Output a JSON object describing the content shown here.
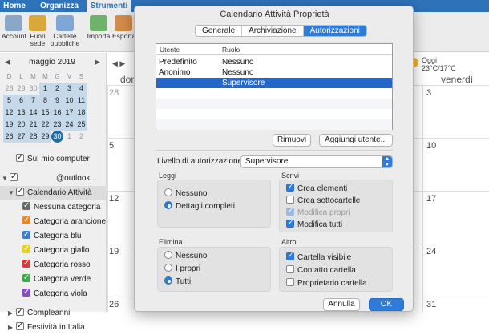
{
  "ribbon": {
    "tabs": [
      {
        "label": "Home",
        "active": false
      },
      {
        "label": "Organizza",
        "active": false
      },
      {
        "label": "Strumenti",
        "active": true
      }
    ],
    "buttons": [
      {
        "label": "Account",
        "icon": "account-icon"
      },
      {
        "label": "Fuori sede",
        "icon": "out-of-office-icon"
      },
      {
        "label": "Cartelle pubbliche",
        "icon": "public-folders-icon"
      },
      {
        "label": "Importa",
        "icon": "import-icon"
      },
      {
        "label": "Esporta",
        "icon": "export-icon"
      }
    ]
  },
  "mini_calendar": {
    "month_label": "maggio 2019",
    "weekdays": [
      "D",
      "L",
      "M",
      "M",
      "G",
      "V",
      "S"
    ],
    "weeks": [
      [
        "28",
        "29",
        "30",
        "1",
        "2",
        "3",
        "4"
      ],
      [
        "5",
        "6",
        "7",
        "8",
        "9",
        "10",
        "11"
      ],
      [
        "12",
        "13",
        "14",
        "15",
        "16",
        "17",
        "18"
      ],
      [
        "19",
        "20",
        "21",
        "22",
        "23",
        "24",
        "25"
      ],
      [
        "26",
        "27",
        "28",
        "29",
        "30",
        "1",
        "2"
      ]
    ],
    "today": "30"
  },
  "calendars": {
    "items": [
      {
        "label": "Sul mio computer",
        "checked": true,
        "type": "account"
      },
      {
        "label": "@outlook...",
        "checked": true,
        "type": "account-expanded"
      },
      {
        "label": "Calendario Attività",
        "checked": true,
        "type": "calendar-expanded"
      },
      {
        "label": "Nessuna categoria",
        "checked": true,
        "color": "#6a6a6a"
      },
      {
        "label": "Categoria arancione",
        "checked": true,
        "color": "#e8862a"
      },
      {
        "label": "Categoria blu",
        "checked": true,
        "color": "#3b7fd4"
      },
      {
        "label": "Categoria giallo",
        "checked": true,
        "color": "#e6d21c"
      },
      {
        "label": "Categoria rosso",
        "checked": true,
        "color": "#d83b3b"
      },
      {
        "label": "Categoria verde",
        "checked": true,
        "color": "#3ea84a"
      },
      {
        "label": "Categoria viola",
        "checked": true,
        "color": "#8a4fc4"
      },
      {
        "label": "Compleanni",
        "checked": true,
        "type": "collapsed"
      },
      {
        "label": "Festività in Italia",
        "checked": true,
        "type": "collapsed"
      }
    ]
  },
  "calendar_view": {
    "day_headers": [
      "dom",
      "venerdì"
    ],
    "weather": {
      "title": "Oggi",
      "temp": "23°C/17°C"
    },
    "rows": [
      {
        "left": "28",
        "right": "3"
      },
      {
        "left": "5",
        "right": "10"
      },
      {
        "left": "12",
        "right": "17"
      },
      {
        "left": "19",
        "right": "24"
      },
      {
        "left": "26",
        "right": "31"
      }
    ]
  },
  "dialog": {
    "title": "Calendario Attività Proprietà",
    "tabs": [
      {
        "label": "Generale",
        "active": false
      },
      {
        "label": "Archiviazione",
        "active": false
      },
      {
        "label": "Autorizzazioni",
        "active": true
      }
    ],
    "table": {
      "columns": [
        "Utente",
        "Ruolo"
      ],
      "rows": [
        {
          "user": "Predefinito",
          "role": "Nessuno",
          "selected": false
        },
        {
          "user": "Anonimo",
          "role": "Nessuno",
          "selected": false
        },
        {
          "user": "",
          "role": "Supervisore",
          "selected": true
        }
      ]
    },
    "remove_label": "Rimuovi",
    "add_user_label": "Aggiungi utente...",
    "level_label": "Livello di autorizzazione:",
    "level_value": "Supervisore",
    "groups": {
      "leggi": {
        "title": "Leggi",
        "options": [
          {
            "label": "Nessuno",
            "checked": false
          },
          {
            "label": "Dettagli completi",
            "checked": true
          }
        ]
      },
      "scrivi": {
        "title": "Scrivi",
        "options": [
          {
            "label": "Crea elementi",
            "checked": true,
            "disabled": false
          },
          {
            "label": "Crea sottocartelle",
            "checked": false,
            "disabled": false
          },
          {
            "label": "Modifica propri",
            "checked": true,
            "disabled": true
          },
          {
            "label": "Modifica tutti",
            "checked": true,
            "disabled": false
          }
        ]
      },
      "elimina": {
        "title": "Elimina",
        "options": [
          {
            "label": "Nessuno",
            "checked": false
          },
          {
            "label": "I propri",
            "checked": false
          },
          {
            "label": "Tutti",
            "checked": true
          }
        ]
      },
      "altro": {
        "title": "Altro",
        "options": [
          {
            "label": "Cartella visibile",
            "checked": true
          },
          {
            "label": "Contatto cartella",
            "checked": false
          },
          {
            "label": "Proprietario cartella",
            "checked": false
          }
        ]
      }
    },
    "cancel_label": "Annulla",
    "ok_label": "OK"
  }
}
